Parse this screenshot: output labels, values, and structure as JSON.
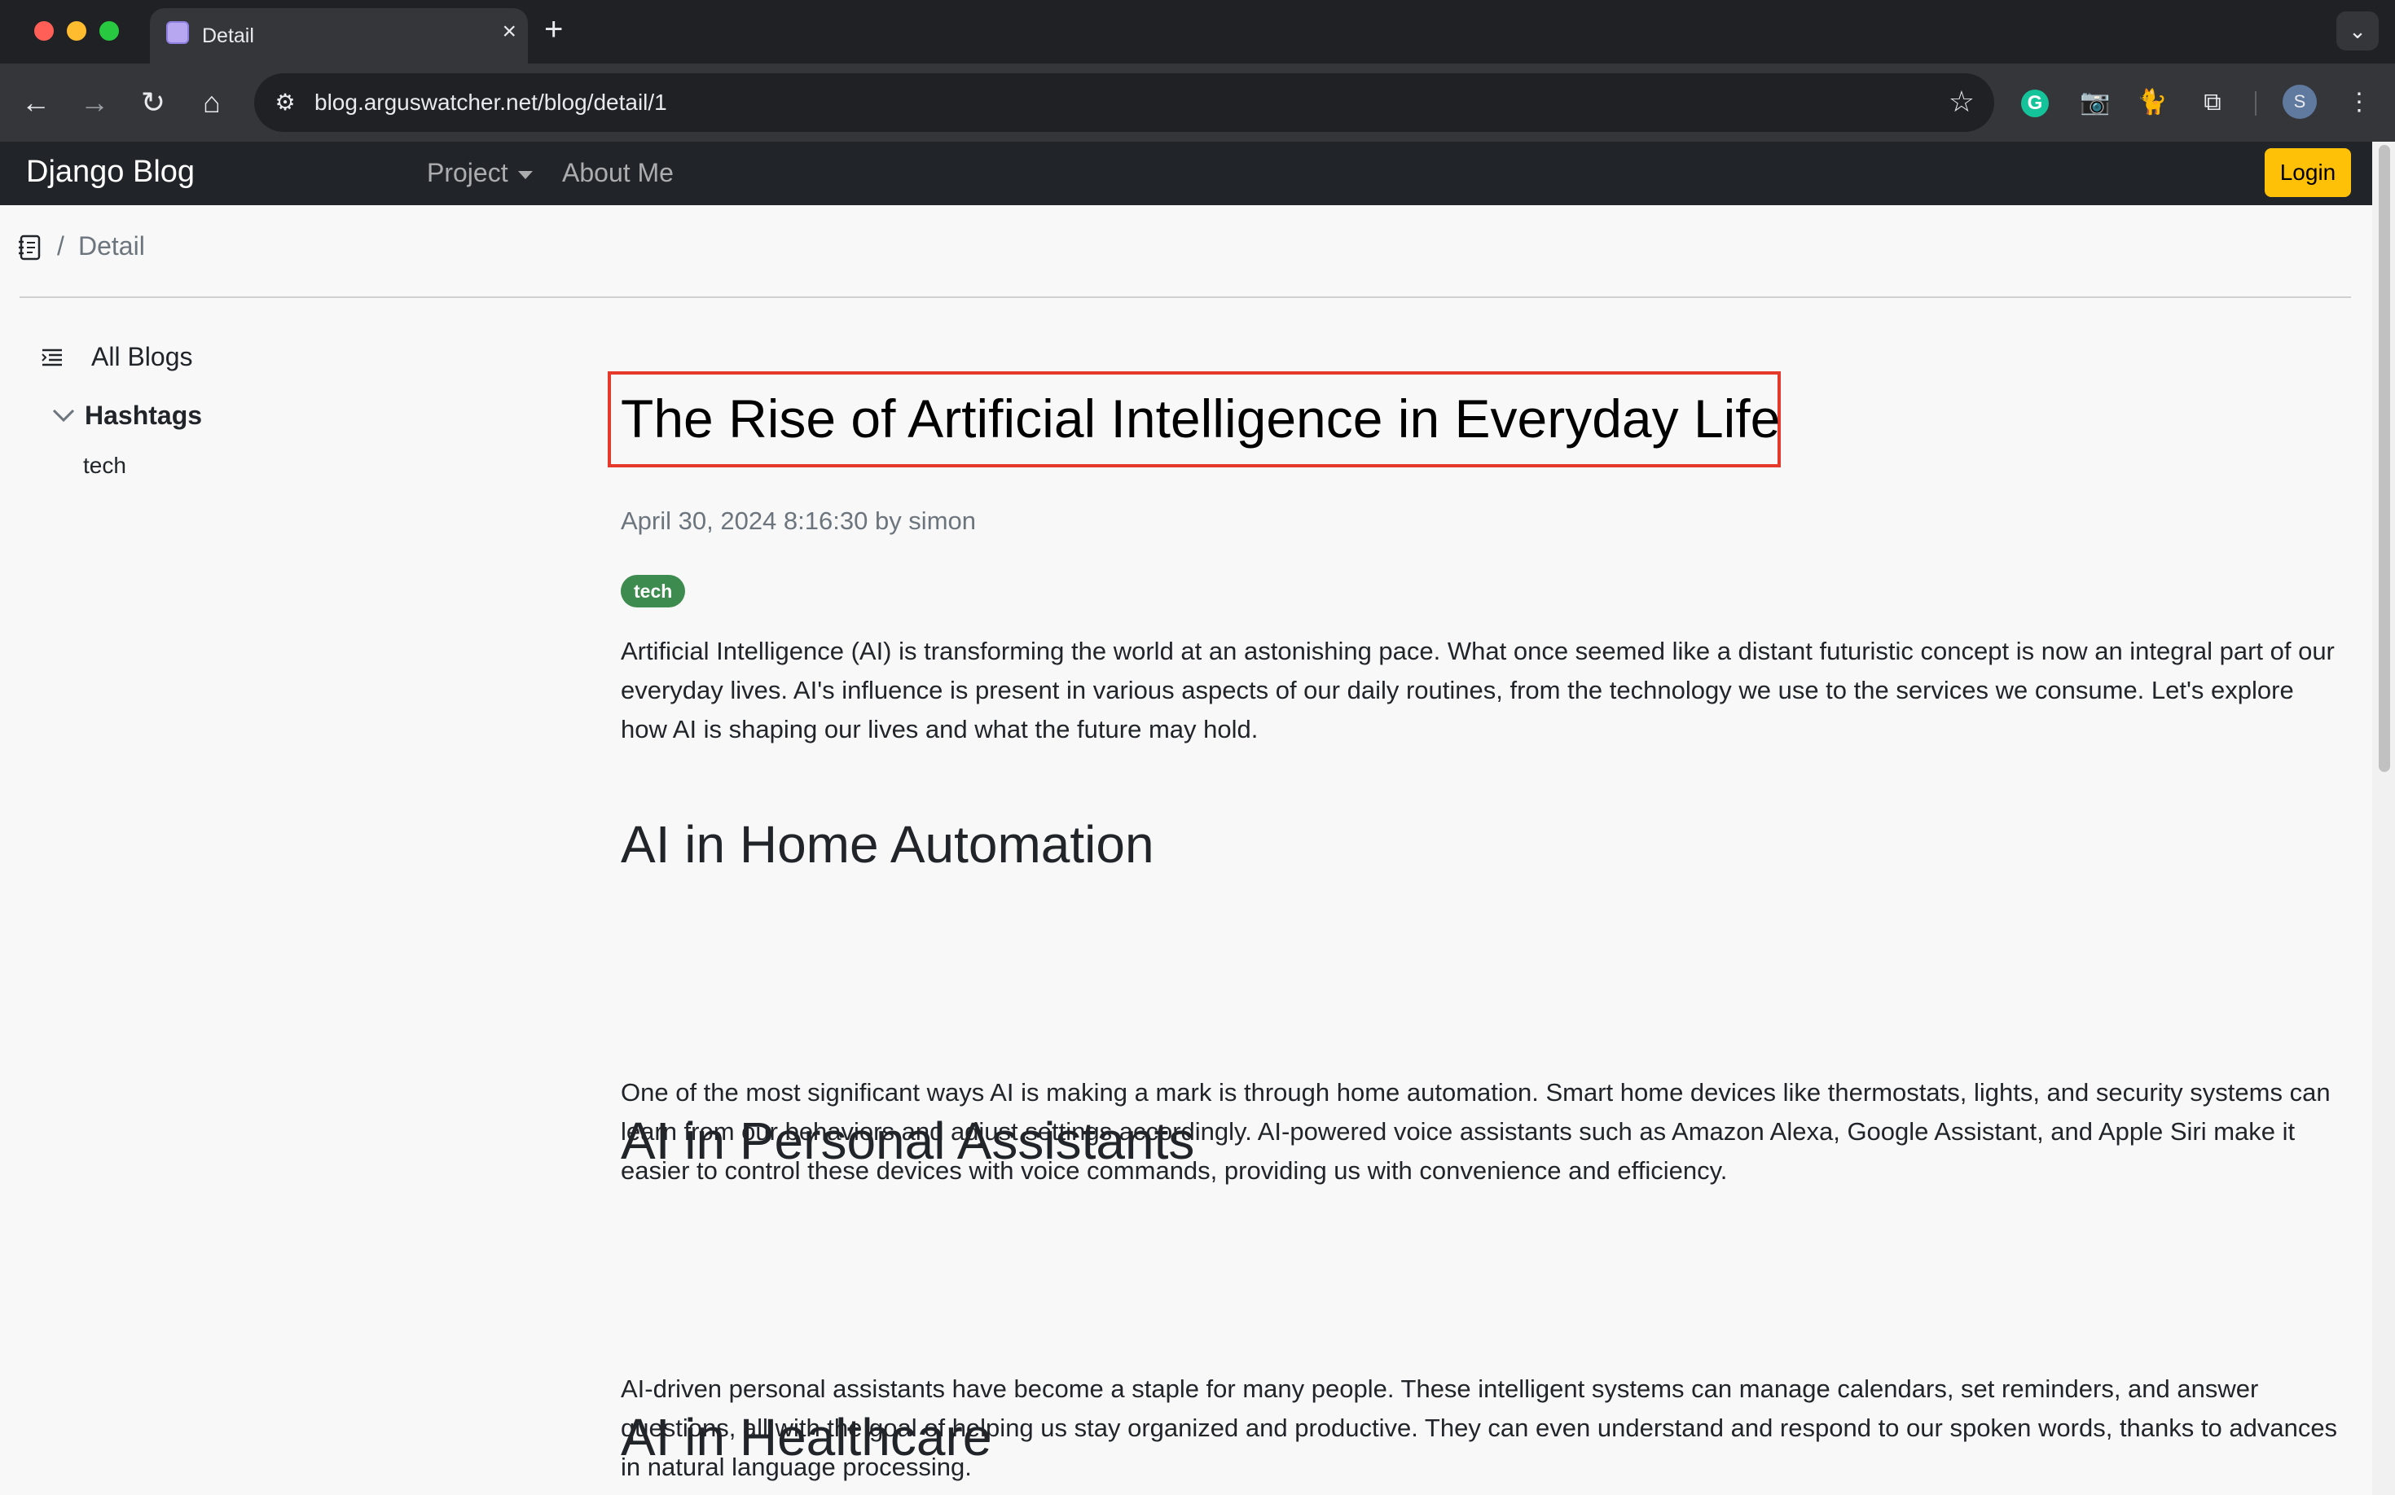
{
  "browser": {
    "tab_title": "Detail",
    "tab_close": "×",
    "new_tab": "+",
    "url": "blog.arguswatcher.net/blog/detail/1",
    "avatar_initial": "S",
    "extension_g": "G"
  },
  "navbar": {
    "brand": "Django Blog",
    "project": "Project",
    "about": "About Me",
    "login": "Login"
  },
  "breadcrumb": {
    "separator": "/",
    "current": "Detail"
  },
  "sidebar": {
    "all_blogs": "All Blogs",
    "hashtags_label": "Hashtags",
    "hashtags": [
      "tech"
    ]
  },
  "post": {
    "title": "The Rise of Artificial Intelligence in Everyday Life",
    "meta": "April 30, 2024 8:16:30 by simon",
    "tag": "tech",
    "intro": "Artificial Intelligence (AI) is transforming the world at an astonishing pace. What once seemed like a distant futuristic concept is now an integral part of our everyday lives. AI's influence is present in various aspects of our daily routines, from the technology we use to the services we consume. Let's explore how AI is shaping our lives and what the future may hold.",
    "sections": [
      {
        "heading": "AI in Home Automation",
        "text": "One of the most significant ways AI is making a mark is through home automation. Smart home devices like thermostats, lights, and security systems can learn from our behaviors and adjust settings accordingly. AI-powered voice assistants such as Amazon Alexa, Google Assistant, and Apple Siri make it easier to control these devices with voice commands, providing us with convenience and efficiency."
      },
      {
        "heading": "AI in Personal Assistants",
        "text": "AI-driven personal assistants have become a staple for many people. These intelligent systems can manage calendars, set reminders, and answer questions, all with the goal of helping us stay organized and productive. They can even understand and respond to our spoken words, thanks to advances in natural language processing."
      },
      {
        "heading": "AI in Healthcare",
        "text": ""
      }
    ]
  },
  "colors": {
    "navbar_bg": "#212529",
    "login_bg": "#ffc107",
    "badge_bg": "#3d8b4f",
    "highlight_border": "#e53a2b"
  }
}
